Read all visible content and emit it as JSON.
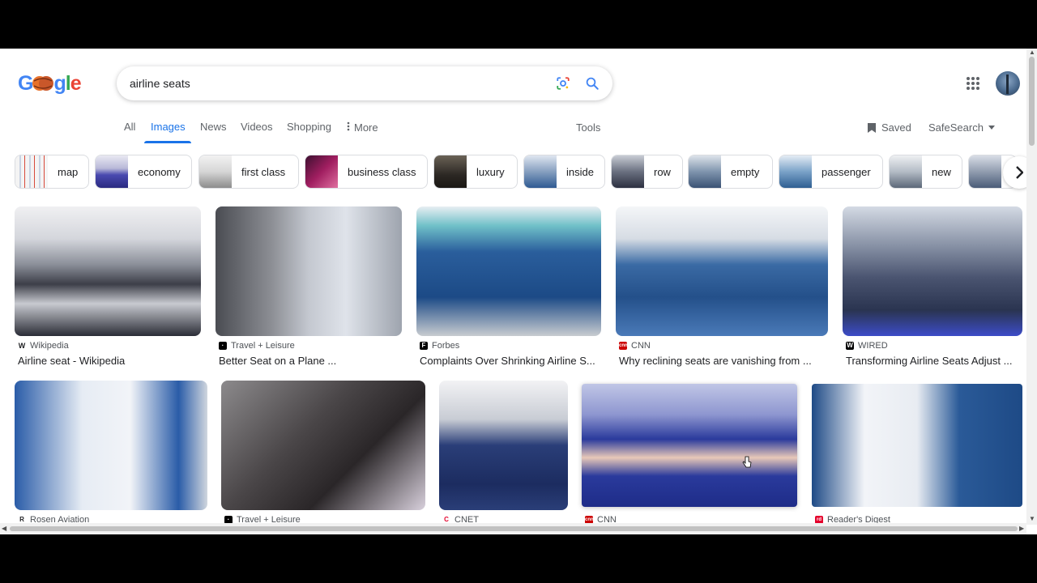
{
  "search": {
    "query": "airline seats"
  },
  "tabs": [
    {
      "label": "All",
      "active": false
    },
    {
      "label": "Images",
      "active": true
    },
    {
      "label": "News",
      "active": false
    },
    {
      "label": "Videos",
      "active": false
    },
    {
      "label": "Shopping",
      "active": false
    },
    {
      "label": "More",
      "active": false
    }
  ],
  "toolbar": {
    "tools": "Tools",
    "saved": "Saved",
    "safesearch": "SafeSearch"
  },
  "chips": [
    {
      "label": "map"
    },
    {
      "label": "economy"
    },
    {
      "label": "first class"
    },
    {
      "label": "business class"
    },
    {
      "label": "luxury"
    },
    {
      "label": "inside"
    },
    {
      "label": "row"
    },
    {
      "label": "empty"
    },
    {
      "label": "passenger"
    },
    {
      "label": "new"
    }
  ],
  "results": [
    {
      "source": "Wikipedia",
      "title": "Airline seat - Wikipedia"
    },
    {
      "source": "Travel + Leisure",
      "title": "Better Seat on a Plane ..."
    },
    {
      "source": "Forbes",
      "title": "Complaints Over Shrinking Airline S..."
    },
    {
      "source": "CNN",
      "title": "Why reclining seats are vanishing from ..."
    },
    {
      "source": "WIRED",
      "title": "Transforming Airline Seats Adjust ..."
    },
    {
      "source": "Rosen Aviation",
      "title": ""
    },
    {
      "source": "Travel + Leisure",
      "title": ""
    },
    {
      "source": "CNET",
      "title": ""
    },
    {
      "source": "CNN",
      "title": ""
    },
    {
      "source": "Reader's Digest",
      "title": ""
    }
  ],
  "icons": {
    "lens": "google-lens-icon",
    "search": "search-icon",
    "apps": "apps-grid-icon",
    "saved": "bookmark-icon",
    "safesearch": "dropdown-caret-icon",
    "chips_next": "chevron-right-icon"
  },
  "colors": {
    "accent": "#1a73e8",
    "text": "#202124",
    "muted": "#5f6368"
  }
}
